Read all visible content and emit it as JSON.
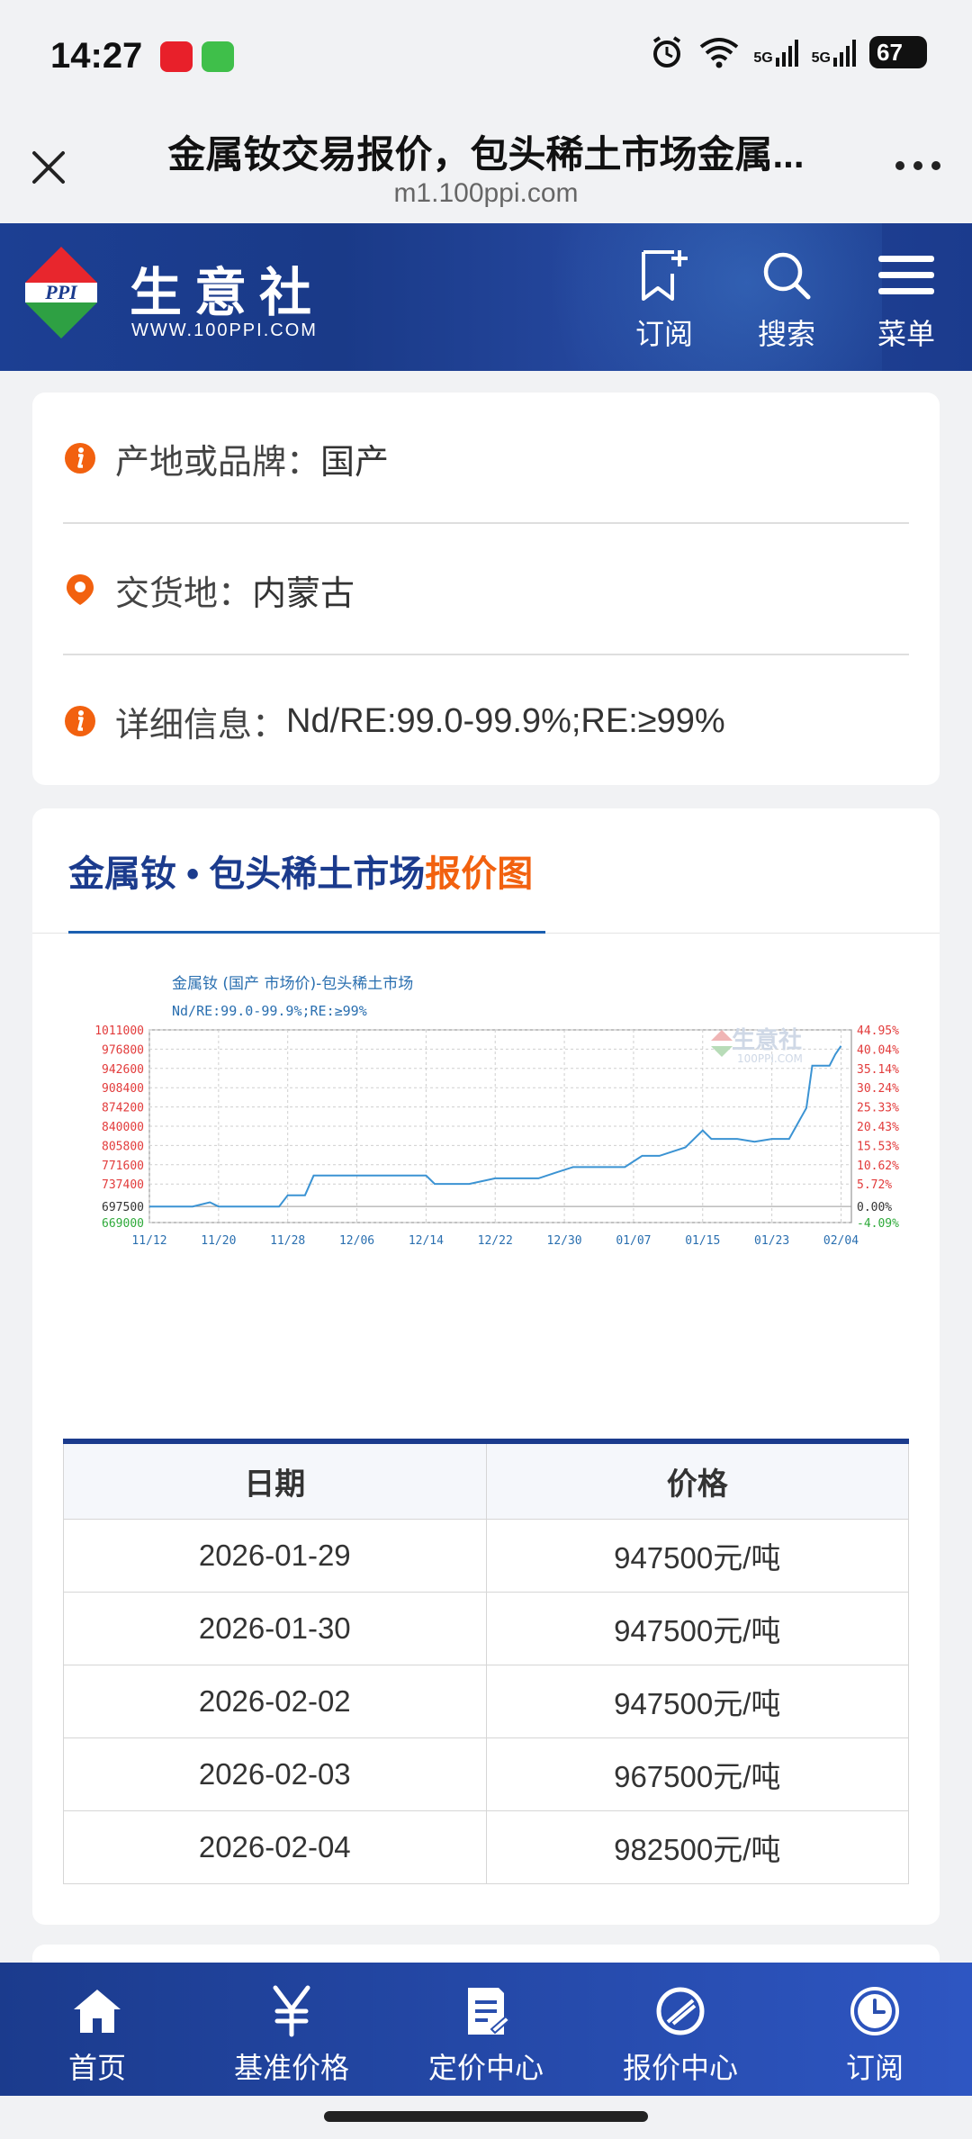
{
  "status_bar": {
    "time": "14:27",
    "signal_1": "5G",
    "signal_2": "5G",
    "battery": "67"
  },
  "browser": {
    "title": "金属钕交易报价，包头稀土市场金属...",
    "url": "m1.100ppi.com"
  },
  "site_header": {
    "brand_name": "生意社",
    "brand_url": "WWW.100PPI.COM",
    "logo_text": "PPI",
    "nav": [
      {
        "label": "订阅",
        "icon": "bookmark-add-icon"
      },
      {
        "label": "搜索",
        "icon": "search-icon"
      },
      {
        "label": "菜单",
        "icon": "menu-icon"
      }
    ]
  },
  "info": {
    "origin_label": "产地或品牌：",
    "origin_value": "国产",
    "delivery_label": "交货地：",
    "delivery_value": "内蒙古",
    "detail_label": "详细信息：",
    "detail_value": "Nd/RE:99.0-99.9%;RE:≥99%"
  },
  "chart_section": {
    "heading_main": "金属钕 • 包头稀土市场",
    "heading_highlight": "报价图"
  },
  "chart_data": {
    "type": "line",
    "title": "金属钕 (国产 市场价)-包头稀土市场",
    "subtitle": "Nd/RE:99.0-99.9%;RE:≥99%",
    "watermark": "生意社",
    "watermark_url": "100PPI.COM",
    "x_tick_labels": [
      "11/12",
      "11/20",
      "11/28",
      "12/06",
      "12/14",
      "12/22",
      "12/30",
      "01/07",
      "01/15",
      "01/23",
      "02/04"
    ],
    "y_left_ticks": [
      1011000,
      976800,
      942600,
      908400,
      874200,
      840000,
      805800,
      771600,
      737400,
      697500,
      669000
    ],
    "y_right_ticks": [
      "44.95%",
      "40.04%",
      "35.14%",
      "30.24%",
      "25.33%",
      "20.43%",
      "15.53%",
      "10.62%",
      "5.72%",
      "0.00%",
      "-4.09%"
    ],
    "ylim": [
      669000,
      1011000
    ],
    "baseline": 697500,
    "grid": true,
    "series": [
      {
        "points": [
          [
            "11/12",
            697500
          ],
          [
            "11/17",
            697500
          ],
          [
            "11/19",
            705000
          ],
          [
            "11/20",
            697500
          ],
          [
            "11/27",
            697500
          ],
          [
            "11/28",
            717500
          ],
          [
            "11/30",
            717500
          ],
          [
            "12/01",
            752500
          ],
          [
            "12/14",
            752500
          ],
          [
            "12/15",
            737500
          ],
          [
            "12/19",
            737500
          ],
          [
            "12/22",
            747500
          ],
          [
            "12/27",
            747500
          ],
          [
            "12/29",
            757500
          ],
          [
            "12/31",
            767500
          ],
          [
            "01/06",
            767500
          ],
          [
            "01/08",
            787500
          ],
          [
            "01/10",
            787500
          ],
          [
            "01/13",
            802500
          ],
          [
            "01/15",
            832500
          ],
          [
            "01/16",
            817500
          ],
          [
            "01/19",
            817500
          ],
          [
            "01/21",
            812500
          ],
          [
            "01/23",
            817500
          ],
          [
            "01/26",
            817500
          ],
          [
            "01/29",
            872500
          ],
          [
            "01/30",
            947500
          ],
          [
            "02/02",
            947500
          ],
          [
            "02/03",
            967500
          ],
          [
            "02/04",
            982500
          ]
        ]
      }
    ]
  },
  "price_table": {
    "headers": [
      "日期",
      "价格"
    ],
    "rows": [
      {
        "date": "2026-01-29",
        "price": "947500元/吨"
      },
      {
        "date": "2026-01-30",
        "price": "947500元/吨"
      },
      {
        "date": "2026-02-02",
        "price": "947500元/吨"
      },
      {
        "date": "2026-02-03",
        "price": "967500元/吨"
      },
      {
        "date": "2026-02-04",
        "price": "982500元/吨"
      }
    ]
  },
  "bottom_nav": [
    {
      "label": "首页",
      "icon": "home-icon"
    },
    {
      "label": "基准价格",
      "icon": "yen-icon"
    },
    {
      "label": "定价中心",
      "icon": "document-icon"
    },
    {
      "label": "报价中心",
      "icon": "quote-icon"
    },
    {
      "label": "订阅",
      "icon": "clock-icon"
    }
  ],
  "colors": {
    "brand_blue": "#1b3b8d",
    "accent_orange": "#f2610f",
    "line_blue": "#3b93d3",
    "axis_red": "#e23b3b",
    "axis_green": "#2eaa3a"
  }
}
